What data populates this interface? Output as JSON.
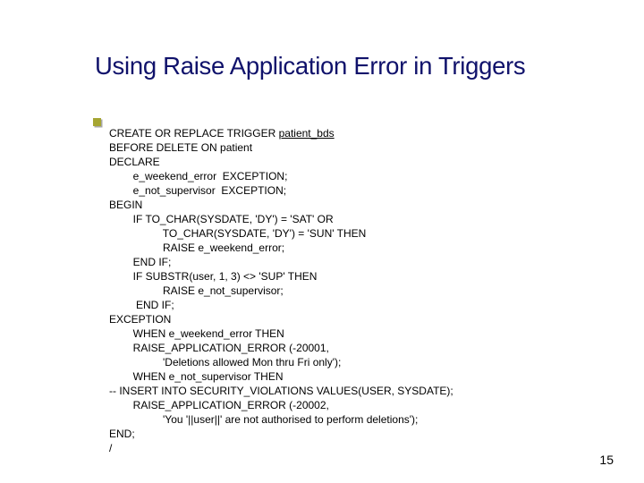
{
  "title": "Using Raise Application Error in Triggers",
  "page_number": "15",
  "code": {
    "l1a": "CREATE OR REPLACE TRIGGER ",
    "l1b": "patient_bds",
    "l2": "BEFORE DELETE ON patient",
    "l3": "DECLARE",
    "l4": "        e_weekend_error  EXCEPTION;",
    "l5": "        e_not_supervisor  EXCEPTION;",
    "l6": "BEGIN",
    "l7": "        IF TO_CHAR(SYSDATE, 'DY') = 'SAT' OR",
    "l8": "                  TO_CHAR(SYSDATE, 'DY') = 'SUN' THEN",
    "l9": "                  RAISE e_weekend_error;",
    "l10": "        END IF;",
    "l11": "        IF SUBSTR(user, 1, 3) <> 'SUP' THEN",
    "l12": "                  RAISE e_not_supervisor;",
    "l13": "         END IF;",
    "l14": "EXCEPTION",
    "l15": "        WHEN e_weekend_error THEN",
    "l16": "        RAISE_APPLICATION_ERROR (-20001,",
    "l17": "                  'Deletions allowed Mon thru Fri only');",
    "l18": "        WHEN e_not_supervisor THEN",
    "l19": "-- INSERT INTO SECURITY_VIOLATIONS VALUES(USER, SYSDATE);",
    "l20": "        RAISE_APPLICATION_ERROR (-20002,",
    "l21": "                  'You '||user||' are not authorised to perform deletions');",
    "l22": "END;",
    "l23": "/"
  }
}
